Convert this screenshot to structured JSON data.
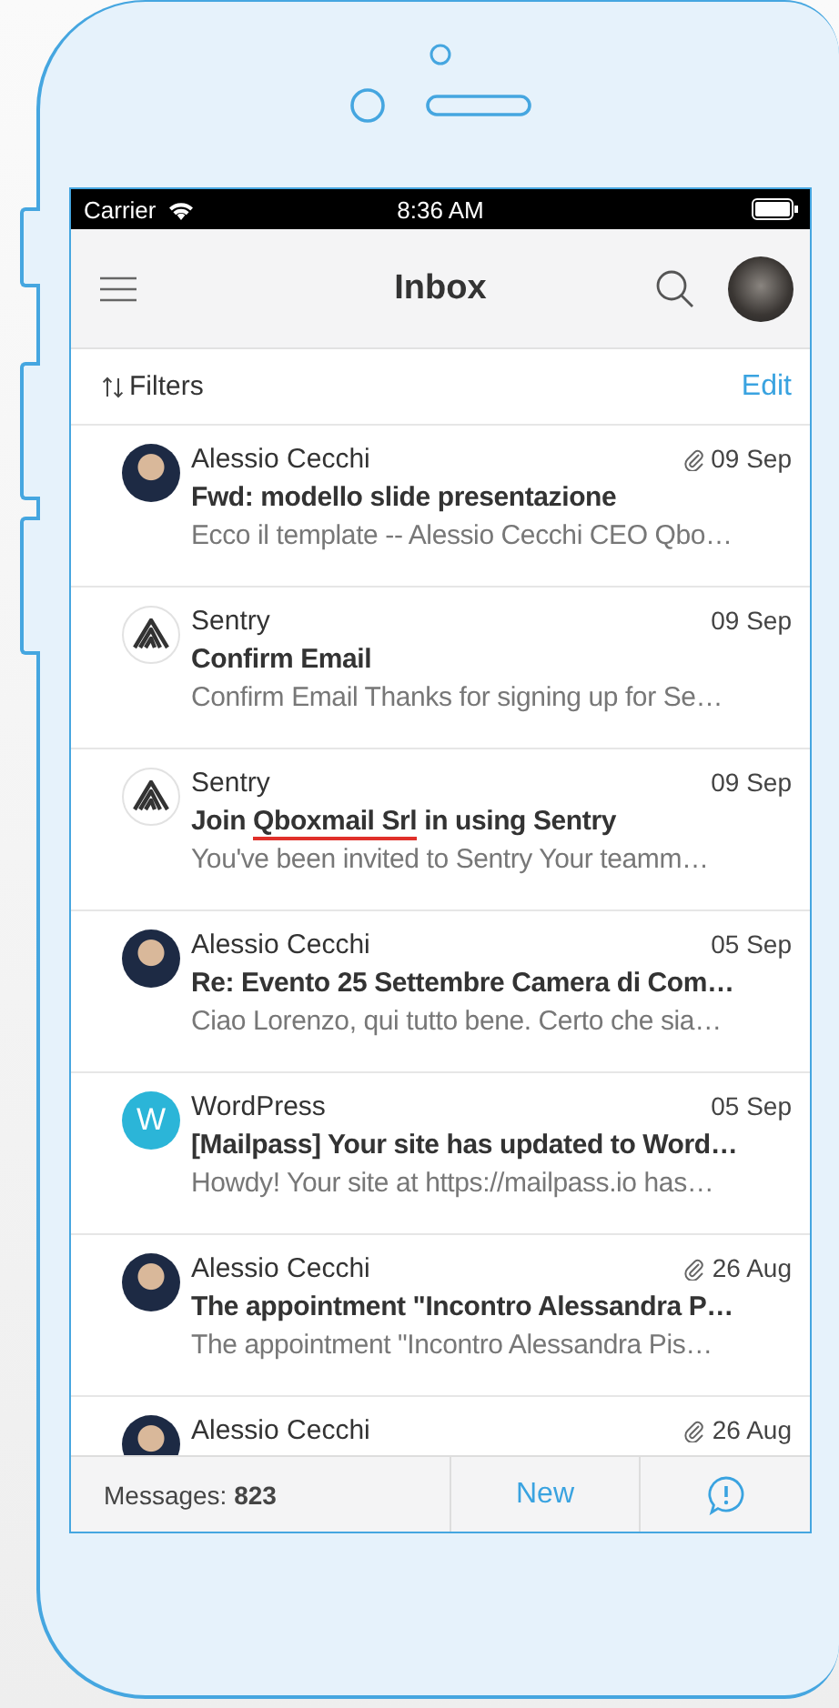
{
  "status_bar": {
    "carrier": "Carrier",
    "time": "8:36 AM"
  },
  "header": {
    "title": "Inbox"
  },
  "filters": {
    "label": "Filters",
    "edit": "Edit"
  },
  "messages": [
    {
      "avatar": {
        "kind": "photo"
      },
      "sender": "Alessio Cecchi",
      "date": "09 Sep",
      "attachment": true,
      "subject": "Fwd: modello slide presentazione",
      "preview": "Ecco il template -- Alessio Cecchi CEO Qbo…"
    },
    {
      "avatar": {
        "kind": "sentry"
      },
      "sender": "Sentry",
      "date": "09 Sep",
      "attachment": false,
      "subject": "Confirm Email",
      "preview": "Confirm Email Thanks for signing up for Se…"
    },
    {
      "avatar": {
        "kind": "sentry"
      },
      "sender": "Sentry",
      "date": "09 Sep",
      "attachment": false,
      "subject": [
        {
          "text": "Join ",
          "redacted": false
        },
        {
          "text": "Qboxmail Srl",
          "redacted": true
        },
        {
          "text": " in using Sentry",
          "redacted": false
        }
      ],
      "preview": "You've been invited to Sentry Your teamm…"
    },
    {
      "avatar": {
        "kind": "photo"
      },
      "sender": "Alessio Cecchi",
      "date": "05 Sep",
      "attachment": false,
      "subject": "Re: Evento 25 Settembre Camera di Com…",
      "preview": "Ciao Lorenzo, qui tutto bene. Certo che sia…"
    },
    {
      "avatar": {
        "kind": "letter",
        "letter": "W",
        "color": "#2bb5d8"
      },
      "sender": "WordPress",
      "date": "05 Sep",
      "attachment": false,
      "subject": "[Mailpass] Your site has updated to Word…",
      "preview": "Howdy! Your site at https://mailpass.io has…"
    },
    {
      "avatar": {
        "kind": "photo"
      },
      "sender": "Alessio Cecchi",
      "date": "26 Aug",
      "attachment": true,
      "subject": "The appointment \"Incontro Alessandra P…",
      "preview": "The appointment \"Incontro Alessandra Pis…"
    },
    {
      "avatar": {
        "kind": "photo"
      },
      "sender": "Alessio Cecchi",
      "date": "26 Aug",
      "attachment": true
    }
  ],
  "footer": {
    "count": "Messages: **823**",
    "new_button": "New"
  }
}
